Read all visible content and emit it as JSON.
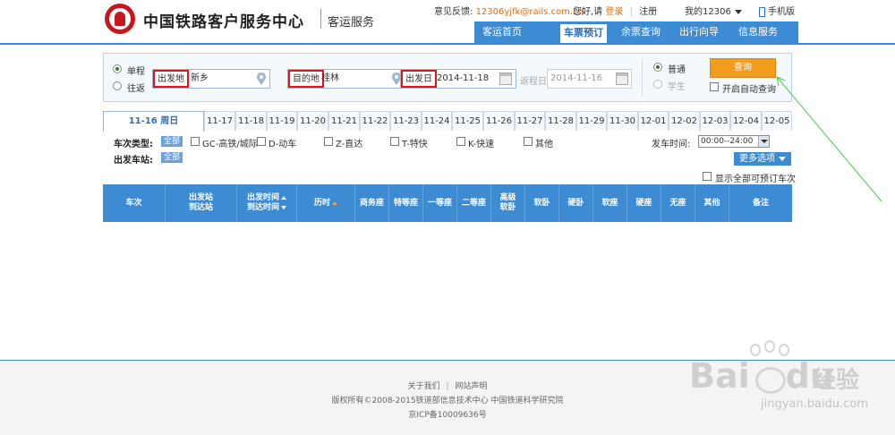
{
  "header": {
    "site_title": "中国铁路客户服务中心",
    "site_subtitle": "客运服务",
    "feedback_label": "意见反馈:",
    "feedback_email": "12306yjfk@rails.com.cn",
    "greeting": "您好,请",
    "login": "登录",
    "register": "注册",
    "my12306": "我的12306",
    "mobile": "手机版"
  },
  "nav": {
    "items": [
      "客运首页",
      "车票预订",
      "余票查询",
      "出行向导",
      "信息服务"
    ],
    "active_index": 1
  },
  "search": {
    "trip_types": [
      "单程",
      "往返"
    ],
    "selected_trip": "单程",
    "from_label": "出发地",
    "from_value": "新乡",
    "to_label": "目的地",
    "to_value": "桂林",
    "date_label": "出发日",
    "date_value": "2014-11-18",
    "return_label": "返程日",
    "return_value": "2014-11-16",
    "ticket_types": [
      "普通",
      "学生"
    ],
    "selected_ticket": "普通",
    "query_button": "查询",
    "auto_query": "开启自动查询"
  },
  "date_tabs": [
    "11-16 周日",
    "11-17",
    "11-18",
    "11-19",
    "11-20",
    "11-21",
    "11-22",
    "11-23",
    "11-24",
    "11-25",
    "11-26",
    "11-27",
    "11-28",
    "11-29",
    "11-30",
    "12-01",
    "12-02",
    "12-03",
    "12-04",
    "12-05"
  ],
  "filters": {
    "train_type_label": "车次类型:",
    "all_label": "全部",
    "train_types": [
      "GC-高铁/城际",
      "D-动车",
      "Z-直达",
      "T-特快",
      "K-快速",
      "其他"
    ],
    "station_label": "出发车站:",
    "depart_time_label": "发车时间:",
    "depart_time_value": "00:00--24:00",
    "more_options": "更多选项",
    "show_all": "显示全部可预订车次"
  },
  "results": {
    "columns": [
      "车次",
      "出发站\n到达站",
      "出发时间\n到达时间",
      "历时",
      "商务座",
      "特等座",
      "一等座",
      "二等座",
      "高级\n软卧",
      "软卧",
      "硬卧",
      "软座",
      "硬座",
      "无座",
      "其他",
      "备注"
    ]
  },
  "footer": {
    "about": "关于我们",
    "statement": "网站声明",
    "copyright": "版权所有©2008-2015铁道部信息技术中心 中国铁道科学研究院",
    "icp": "京ICP备10009636号"
  },
  "watermark": {
    "brand": "Bai",
    "brand_tail": "du",
    "brand_cn": "经验",
    "url": "jingyan.baidu.com"
  },
  "colors": {
    "brand_blue": "#3d8bd3",
    "query_orange": "#f39d1f",
    "highlight_red": "#e0141a",
    "logo_red": "#c8161e"
  }
}
